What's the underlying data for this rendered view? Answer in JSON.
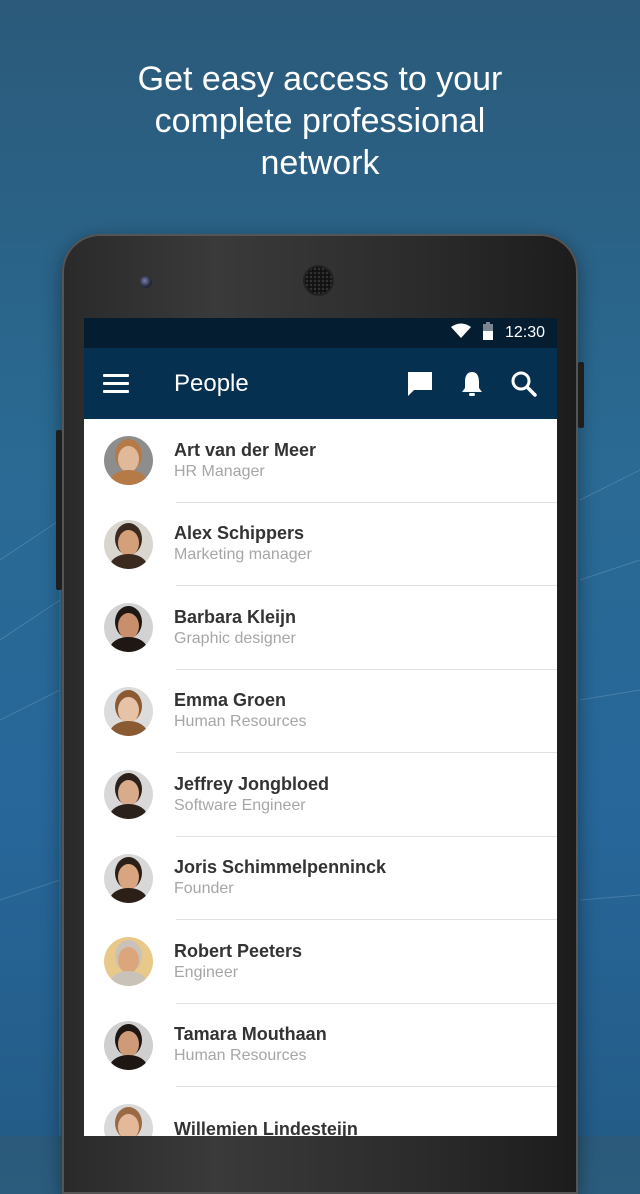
{
  "headline": {
    "lines": [
      "Get easy access to your",
      "complete professional",
      "network"
    ]
  },
  "status_bar": {
    "wifi_icon": "wifi-icon",
    "battery_icon": "battery-icon",
    "time": "12:30"
  },
  "app_bar": {
    "menu_icon": "hamburger-menu-icon",
    "title": "People",
    "actions": [
      {
        "icon": "chat-icon",
        "label": "Messages"
      },
      {
        "icon": "bell-icon",
        "label": "Notifications"
      },
      {
        "icon": "search-icon",
        "label": "Search"
      }
    ]
  },
  "people": [
    {
      "name": "Art van der Meer",
      "role": "HR Manager",
      "skin": "#e0b89a",
      "hair": "#b57a45",
      "bg": "#8d8d8d"
    },
    {
      "name": "Alex Schippers",
      "role": "Marketing manager",
      "skin": "#d4a07a",
      "hair": "#3b2a20",
      "bg": "#d9d6d0"
    },
    {
      "name": "Barbara Kleijn",
      "role": "Graphic designer",
      "skin": "#c98f6d",
      "hair": "#1f1714",
      "bg": "#d2d2d2"
    },
    {
      "name": "Emma Groen",
      "role": "Human Resources",
      "skin": "#e6c2a6",
      "hair": "#8a5a33",
      "bg": "#dcdcdc"
    },
    {
      "name": "Jeffrey Jongbloed",
      "role": "Software Engineer",
      "skin": "#d8ab8a",
      "hair": "#2b211b",
      "bg": "#d8d8d8"
    },
    {
      "name": "Joris Schimmelpenninck",
      "role": "Founder",
      "skin": "#d9a581",
      "hair": "#2c1f17",
      "bg": "#d8d8d8"
    },
    {
      "name": "Robert Peeters",
      "role": "Engineer",
      "skin": "#dba67c",
      "hair": "#c9c2b8",
      "bg": "#e9c98a"
    },
    {
      "name": "Tamara Mouthaan",
      "role": "Human Resources",
      "skin": "#cf9a78",
      "hair": "#1e1613",
      "bg": "#cfcfcf"
    },
    {
      "name": "Willemien Lindesteijn",
      "role": "",
      "skin": "#e3b99a",
      "hair": "#9a6a45",
      "bg": "#d9d9d9"
    }
  ]
}
